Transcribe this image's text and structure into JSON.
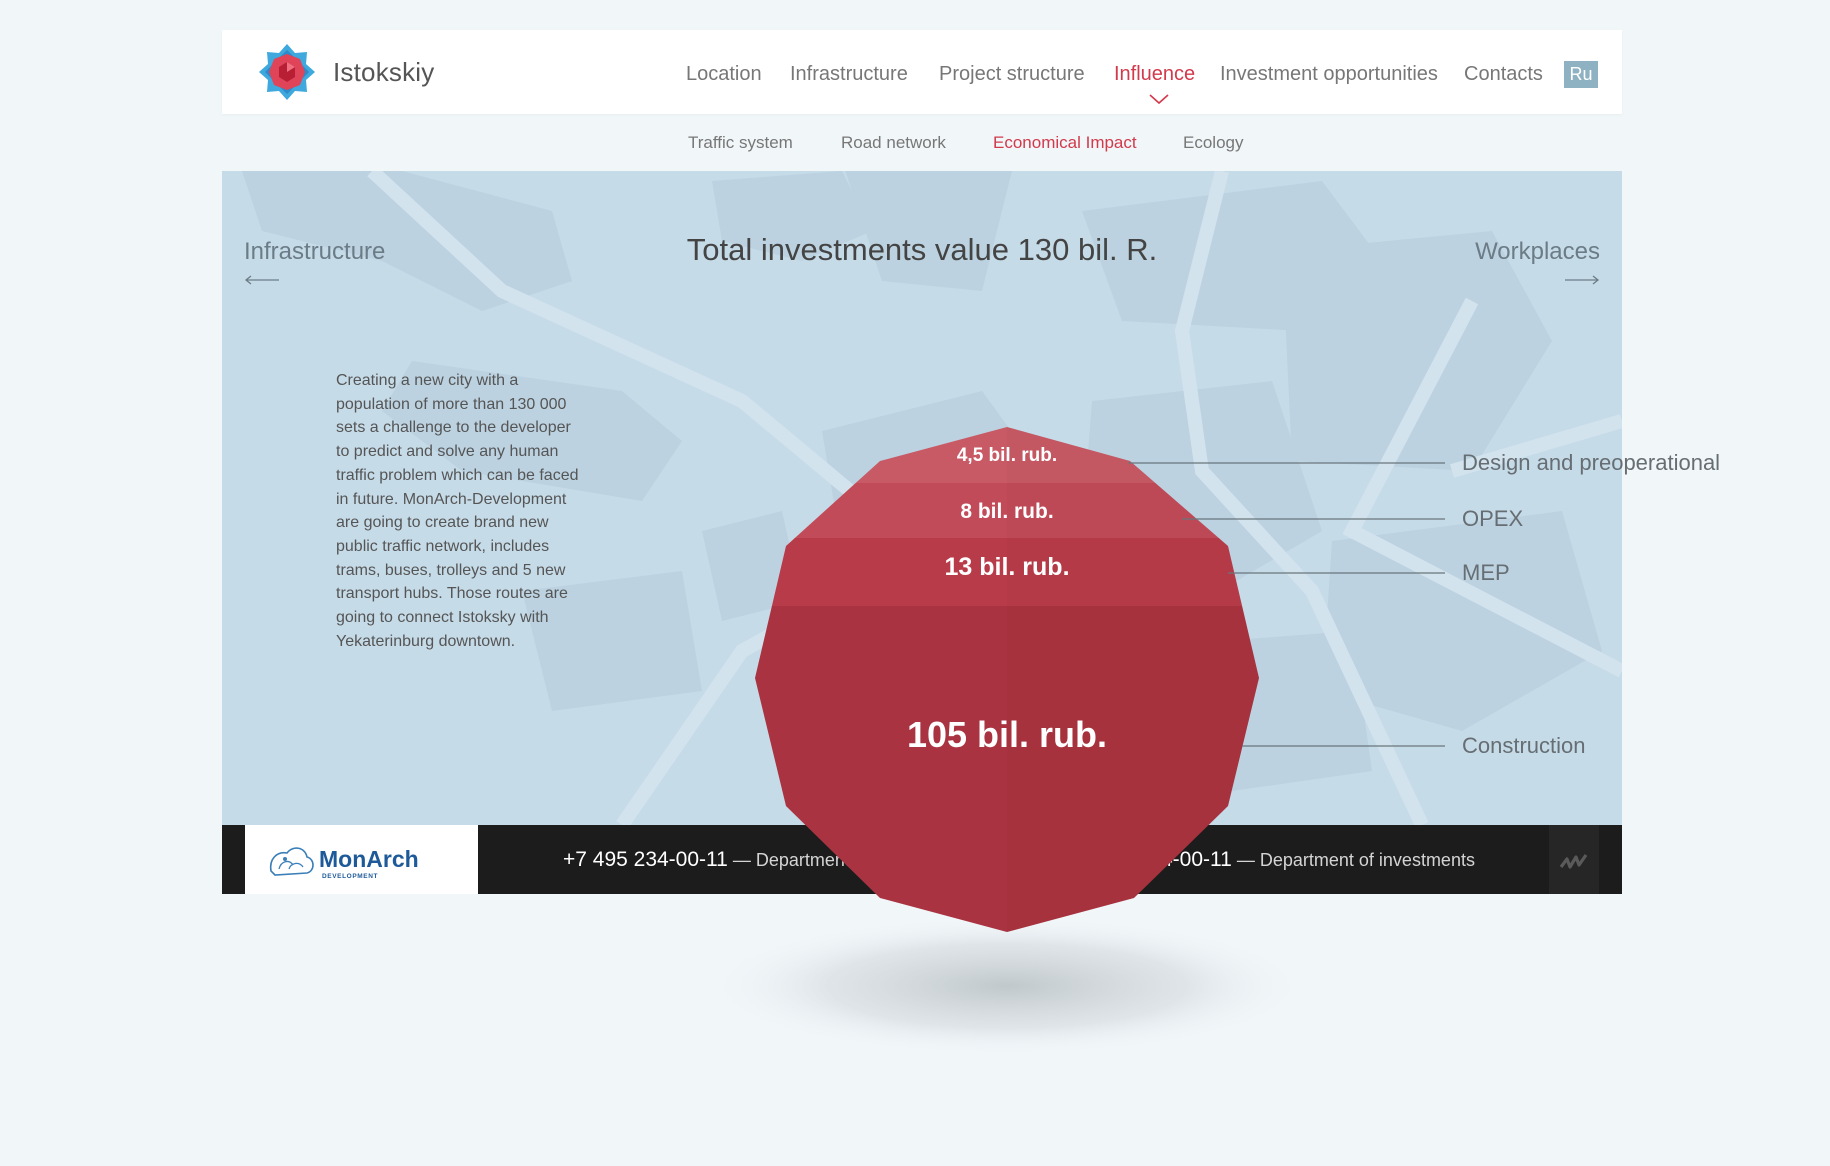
{
  "header": {
    "brand": "Istokskiy",
    "nav": [
      {
        "label": "Location",
        "active": false
      },
      {
        "label": "Infrastructure",
        "active": false
      },
      {
        "label": "Project structure",
        "active": false
      },
      {
        "label": "Influence",
        "active": true
      },
      {
        "label": "Investment opportunities",
        "active": false
      },
      {
        "label": "Contacts",
        "active": false
      }
    ],
    "lang": "Ru"
  },
  "subnav": [
    {
      "label": "Traffic system",
      "active": false
    },
    {
      "label": "Road network",
      "active": false
    },
    {
      "label": "Economical Impact",
      "active": true
    },
    {
      "label": "Ecology",
      "active": false
    }
  ],
  "stage": {
    "title": "Total investments value 130 bil. R.",
    "prev_label": "Infrastructure",
    "next_label": "Workplaces",
    "description": "Creating a new city with a population of more than 130 000 sets a challenge to the developer to predict and solve any human traffic problem which can be faced in future. MonArch-Development are going to create brand new public traffic network, includes trams, buses, trolleys and 5 new transport hubs. Those routes are going to connect Istoksky with Yekaterinburg downtown."
  },
  "chart_data": {
    "type": "stacked-polygon",
    "title": "Total investments value 130 bil. R.",
    "unit": "bil. rub.",
    "segments": [
      {
        "name": "Design and preoperational",
        "value": 4.5,
        "label": "4,5 bil. rub.",
        "color": "#c85a66"
      },
      {
        "name": "OPEX",
        "value": 8,
        "label": "8 bil. rub.",
        "color": "#c24b59"
      },
      {
        "name": "MEP",
        "value": 13,
        "label": "13 bil. rub.",
        "color": "#b83b4a"
      },
      {
        "name": "Construction",
        "value": 105,
        "label": "105 bil. rub.",
        "color": "#a93340"
      }
    ]
  },
  "footer": {
    "logo_name": "MonArch",
    "logo_sub": "DEVELOPMENT",
    "phone1": "+7 495 234-00-11",
    "dept1": "— Department of investments",
    "phone2": "+7 495 234-00-11",
    "dept2": "— Department of investments"
  },
  "colors": {
    "accent": "#d23a4c",
    "stage_bg": "#c6dbe8",
    "page_bg": "#f1f6f9",
    "footer_bg": "#1c1c1c"
  }
}
